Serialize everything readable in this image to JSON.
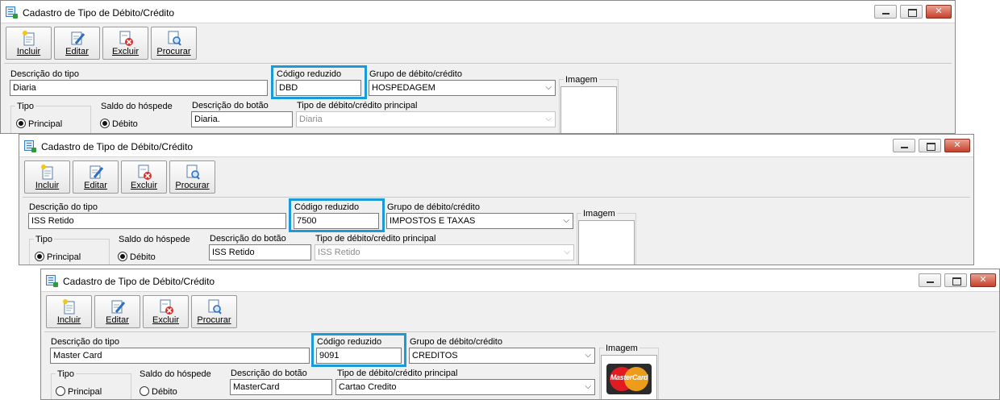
{
  "windows": [
    {
      "title": "Cadastro de Tipo de Débito/Crédito",
      "toolbar": [
        "Incluir",
        "Editar",
        "Excluir",
        "Procurar"
      ],
      "labels": {
        "descricao_tipo": "Descrição do tipo",
        "codigo_reduzido": "Código reduzido",
        "grupo": "Grupo de débito/crédito",
        "imagem": "Imagem",
        "tipo": "Tipo",
        "saldo": "Saldo do hóspede",
        "descricao_botao": "Descrição do botão",
        "tipo_principal": "Tipo de débito/crédito principal",
        "principal": "Principal",
        "debito": "Débito"
      },
      "values": {
        "descricao_tipo": "Diaria",
        "codigo_reduzido": "DBD",
        "grupo": "HOSPEDAGEM",
        "descricao_botao": "Diaria.",
        "tipo_principal": "Diaria"
      },
      "radios": {
        "principal_selected": true,
        "debito_selected": true
      }
    },
    {
      "title": "Cadastro de Tipo de Débito/Crédito",
      "toolbar": [
        "Incluir",
        "Editar",
        "Excluir",
        "Procurar"
      ],
      "labels": {
        "descricao_tipo": "Descrição do tipo",
        "codigo_reduzido": "Código reduzido",
        "grupo": "Grupo de débito/crédito",
        "imagem": "Imagem",
        "tipo": "Tipo",
        "saldo": "Saldo do hóspede",
        "descricao_botao": "Descrição do botão",
        "tipo_principal": "Tipo de débito/crédito principal",
        "principal": "Principal",
        "debito": "Débito"
      },
      "values": {
        "descricao_tipo": "ISS Retido",
        "codigo_reduzido": "7500",
        "grupo": "IMPOSTOS E TAXAS",
        "descricao_botao": "ISS Retido",
        "tipo_principal": "ISS Retido"
      },
      "radios": {
        "principal_selected": true,
        "debito_selected": true
      }
    },
    {
      "title": "Cadastro de Tipo de Débito/Crédito",
      "toolbar": [
        "Incluir",
        "Editar",
        "Excluir",
        "Procurar"
      ],
      "labels": {
        "descricao_tipo": "Descrição do tipo",
        "codigo_reduzido": "Código reduzido",
        "grupo": "Grupo de débito/crédito",
        "imagem": "Imagem",
        "tipo": "Tipo",
        "saldo": "Saldo do hóspede",
        "descricao_botao": "Descrição do botão",
        "tipo_principal": "Tipo de débito/crédito principal",
        "principal": "Principal",
        "debito": "Débito"
      },
      "values": {
        "descricao_tipo": "Master Card",
        "codigo_reduzido": "9091",
        "grupo": "CREDITOS",
        "descricao_botao": "MasterCard",
        "tipo_principal": "Cartao Credito"
      },
      "radios": {
        "principal_selected": false,
        "debito_selected": false
      },
      "image_logo_text": "MasterCard"
    }
  ],
  "colors": {
    "highlight": "#1a9ad6",
    "window_bg": "#f0f0f0"
  },
  "icons": [
    "app-icon",
    "include-icon",
    "edit-icon",
    "delete-icon",
    "search-icon",
    "mastercard-logo"
  ]
}
